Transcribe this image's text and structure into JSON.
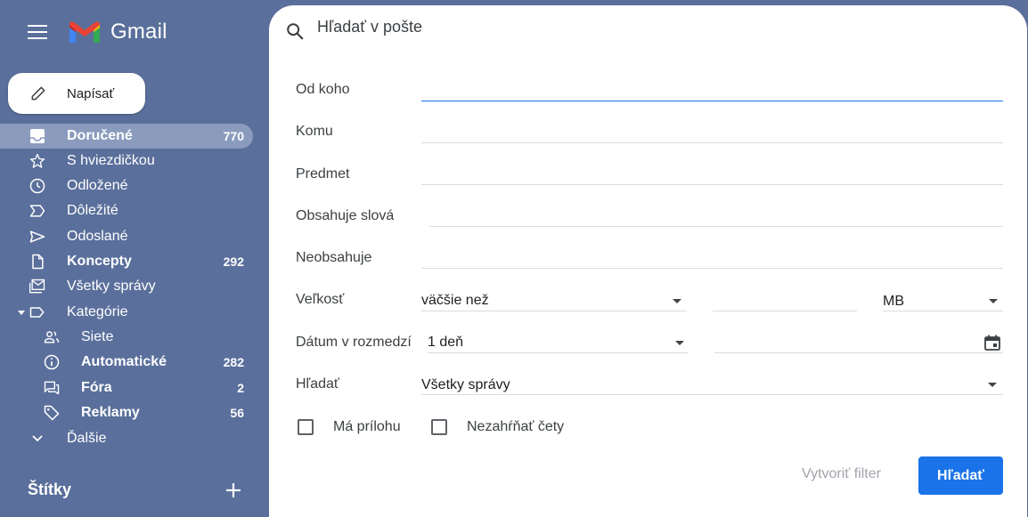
{
  "app": {
    "name": "Gmail"
  },
  "search": {
    "placeholder": "Hľadať v pošte"
  },
  "compose": {
    "label": "Napísať"
  },
  "nav": [
    {
      "label": "Doručené",
      "count": "770",
      "icon": "inbox-icon",
      "bold": true,
      "active": true
    },
    {
      "label": "S hviezdičkou",
      "count": "",
      "icon": "star-icon"
    },
    {
      "label": "Odložené",
      "count": "",
      "icon": "clock-icon"
    },
    {
      "label": "Dôležité",
      "count": "",
      "icon": "important-icon"
    },
    {
      "label": "Odoslané",
      "count": "",
      "icon": "send-icon"
    },
    {
      "label": "Koncepty",
      "count": "292",
      "icon": "draft-icon",
      "bold": true
    },
    {
      "label": "Všetky správy",
      "count": "",
      "icon": "all-mail-icon"
    },
    {
      "label": "Kategórie",
      "count": "",
      "icon": "label-icon"
    },
    {
      "label": "Siete",
      "count": "",
      "icon": "people-icon"
    },
    {
      "label": "Automatické",
      "count": "282",
      "icon": "info-icon",
      "bold": true
    },
    {
      "label": "Fóra",
      "count": "2",
      "icon": "forum-icon",
      "bold": true
    },
    {
      "label": "Reklamy",
      "count": "56",
      "icon": "tag-icon",
      "bold": true
    },
    {
      "label": "Ďalšie",
      "count": "",
      "icon": "chevron-down-icon"
    }
  ],
  "labels_heading": "Štítky",
  "form": {
    "from_label": "Od koho",
    "to_label": "Komu",
    "subject_label": "Predmet",
    "has_words_label": "Obsahuje slová",
    "no_words_label": "Neobsahuje",
    "size_label": "Veľkosť",
    "size_operator": "väčšie než",
    "size_value": "",
    "size_unit": "MB",
    "date_label": "Dátum v rozmedzí",
    "date_range": "1 deň",
    "date_value": "",
    "search_in_label": "Hľadať",
    "search_in_value": "Všetky správy",
    "has_attachment_label": "Má prílohu",
    "exclude_chats_label": "Nezahŕňať čety",
    "create_filter_label": "Vytvoriť filter",
    "search_button_label": "Hľadať"
  },
  "colors": {
    "sidebar_bg": "#5a6f9b",
    "accent": "#1a73e8",
    "active_item_bg": "#8a9bbd"
  }
}
